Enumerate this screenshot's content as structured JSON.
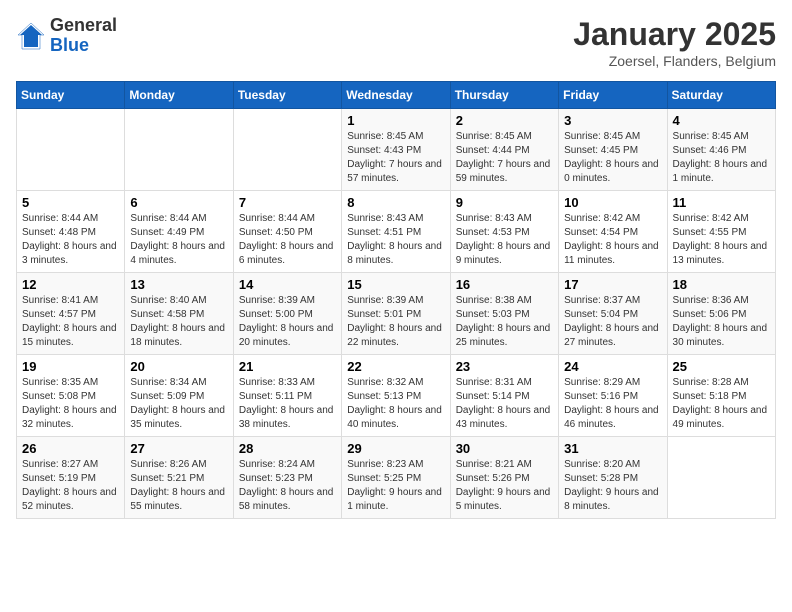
{
  "logo": {
    "general": "General",
    "blue": "Blue"
  },
  "title": "January 2025",
  "subtitle": "Zoersel, Flanders, Belgium",
  "weekdays": [
    "Sunday",
    "Monday",
    "Tuesday",
    "Wednesday",
    "Thursday",
    "Friday",
    "Saturday"
  ],
  "weeks": [
    [
      {
        "day": "",
        "info": ""
      },
      {
        "day": "",
        "info": ""
      },
      {
        "day": "",
        "info": ""
      },
      {
        "day": "1",
        "info": "Sunrise: 8:45 AM\nSunset: 4:43 PM\nDaylight: 7 hours and 57 minutes."
      },
      {
        "day": "2",
        "info": "Sunrise: 8:45 AM\nSunset: 4:44 PM\nDaylight: 7 hours and 59 minutes."
      },
      {
        "day": "3",
        "info": "Sunrise: 8:45 AM\nSunset: 4:45 PM\nDaylight: 8 hours and 0 minutes."
      },
      {
        "day": "4",
        "info": "Sunrise: 8:45 AM\nSunset: 4:46 PM\nDaylight: 8 hours and 1 minute."
      }
    ],
    [
      {
        "day": "5",
        "info": "Sunrise: 8:44 AM\nSunset: 4:48 PM\nDaylight: 8 hours and 3 minutes."
      },
      {
        "day": "6",
        "info": "Sunrise: 8:44 AM\nSunset: 4:49 PM\nDaylight: 8 hours and 4 minutes."
      },
      {
        "day": "7",
        "info": "Sunrise: 8:44 AM\nSunset: 4:50 PM\nDaylight: 8 hours and 6 minutes."
      },
      {
        "day": "8",
        "info": "Sunrise: 8:43 AM\nSunset: 4:51 PM\nDaylight: 8 hours and 8 minutes."
      },
      {
        "day": "9",
        "info": "Sunrise: 8:43 AM\nSunset: 4:53 PM\nDaylight: 8 hours and 9 minutes."
      },
      {
        "day": "10",
        "info": "Sunrise: 8:42 AM\nSunset: 4:54 PM\nDaylight: 8 hours and 11 minutes."
      },
      {
        "day": "11",
        "info": "Sunrise: 8:42 AM\nSunset: 4:55 PM\nDaylight: 8 hours and 13 minutes."
      }
    ],
    [
      {
        "day": "12",
        "info": "Sunrise: 8:41 AM\nSunset: 4:57 PM\nDaylight: 8 hours and 15 minutes."
      },
      {
        "day": "13",
        "info": "Sunrise: 8:40 AM\nSunset: 4:58 PM\nDaylight: 8 hours and 18 minutes."
      },
      {
        "day": "14",
        "info": "Sunrise: 8:39 AM\nSunset: 5:00 PM\nDaylight: 8 hours and 20 minutes."
      },
      {
        "day": "15",
        "info": "Sunrise: 8:39 AM\nSunset: 5:01 PM\nDaylight: 8 hours and 22 minutes."
      },
      {
        "day": "16",
        "info": "Sunrise: 8:38 AM\nSunset: 5:03 PM\nDaylight: 8 hours and 25 minutes."
      },
      {
        "day": "17",
        "info": "Sunrise: 8:37 AM\nSunset: 5:04 PM\nDaylight: 8 hours and 27 minutes."
      },
      {
        "day": "18",
        "info": "Sunrise: 8:36 AM\nSunset: 5:06 PM\nDaylight: 8 hours and 30 minutes."
      }
    ],
    [
      {
        "day": "19",
        "info": "Sunrise: 8:35 AM\nSunset: 5:08 PM\nDaylight: 8 hours and 32 minutes."
      },
      {
        "day": "20",
        "info": "Sunrise: 8:34 AM\nSunset: 5:09 PM\nDaylight: 8 hours and 35 minutes."
      },
      {
        "day": "21",
        "info": "Sunrise: 8:33 AM\nSunset: 5:11 PM\nDaylight: 8 hours and 38 minutes."
      },
      {
        "day": "22",
        "info": "Sunrise: 8:32 AM\nSunset: 5:13 PM\nDaylight: 8 hours and 40 minutes."
      },
      {
        "day": "23",
        "info": "Sunrise: 8:31 AM\nSunset: 5:14 PM\nDaylight: 8 hours and 43 minutes."
      },
      {
        "day": "24",
        "info": "Sunrise: 8:29 AM\nSunset: 5:16 PM\nDaylight: 8 hours and 46 minutes."
      },
      {
        "day": "25",
        "info": "Sunrise: 8:28 AM\nSunset: 5:18 PM\nDaylight: 8 hours and 49 minutes."
      }
    ],
    [
      {
        "day": "26",
        "info": "Sunrise: 8:27 AM\nSunset: 5:19 PM\nDaylight: 8 hours and 52 minutes."
      },
      {
        "day": "27",
        "info": "Sunrise: 8:26 AM\nSunset: 5:21 PM\nDaylight: 8 hours and 55 minutes."
      },
      {
        "day": "28",
        "info": "Sunrise: 8:24 AM\nSunset: 5:23 PM\nDaylight: 8 hours and 58 minutes."
      },
      {
        "day": "29",
        "info": "Sunrise: 8:23 AM\nSunset: 5:25 PM\nDaylight: 9 hours and 1 minute."
      },
      {
        "day": "30",
        "info": "Sunrise: 8:21 AM\nSunset: 5:26 PM\nDaylight: 9 hours and 5 minutes."
      },
      {
        "day": "31",
        "info": "Sunrise: 8:20 AM\nSunset: 5:28 PM\nDaylight: 9 hours and 8 minutes."
      },
      {
        "day": "",
        "info": ""
      }
    ]
  ]
}
